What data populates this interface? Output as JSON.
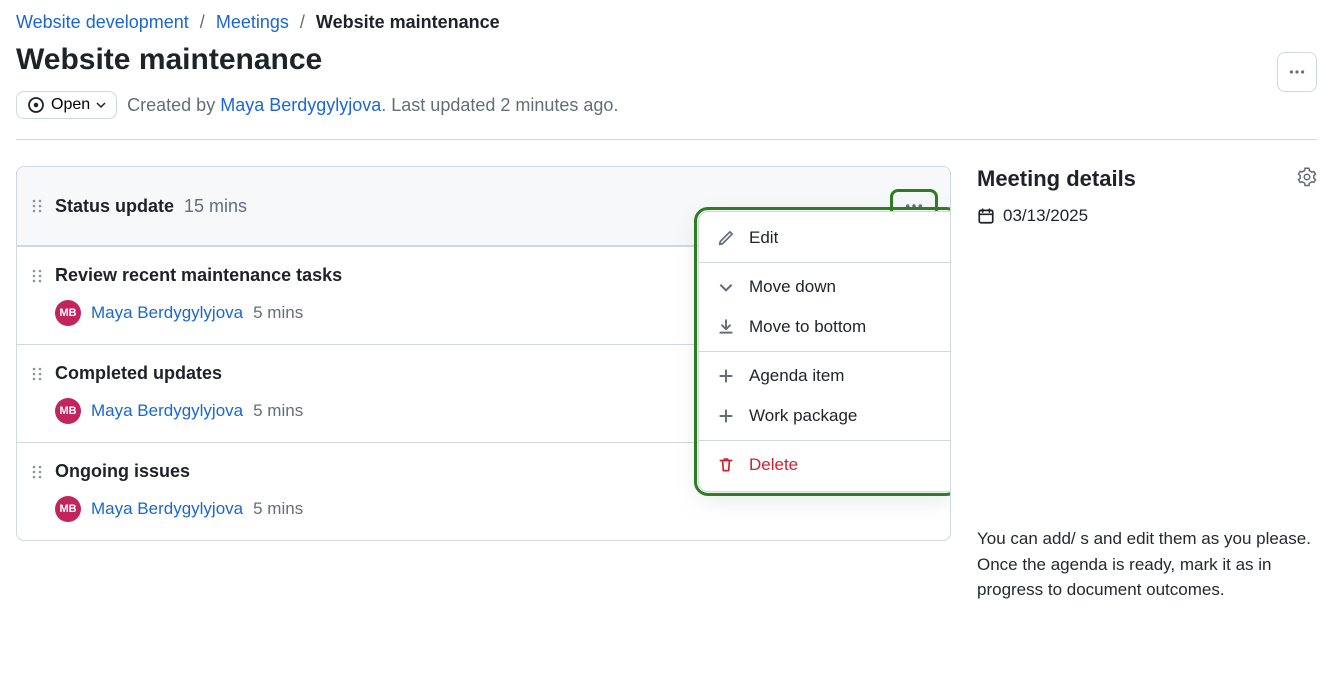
{
  "breadcrumb": {
    "root": "Website development",
    "mid": "Meetings",
    "current": "Website maintenance"
  },
  "page": {
    "title": "Website maintenance",
    "status_label": "Open",
    "created_by_prefix": "Created by ",
    "created_by": "Maya Berdygylyjova",
    "updated_suffix": ". Last updated 2 minutes ago."
  },
  "agenda": {
    "group": {
      "title": "Status update",
      "duration": "15 mins"
    },
    "items": [
      {
        "title": "Review recent maintenance tasks",
        "assignee": "Maya Berdygylyjova",
        "initials": "MB",
        "duration": "5 mins"
      },
      {
        "title": "Completed updates",
        "assignee": "Maya Berdygylyjova",
        "initials": "MB",
        "duration": "5 mins"
      },
      {
        "title": "Ongoing issues",
        "assignee": "Maya Berdygylyjova",
        "initials": "MB",
        "duration": "5 mins"
      }
    ]
  },
  "menu": {
    "edit": "Edit",
    "move_down": "Move down",
    "move_bottom": "Move to bottom",
    "agenda_item": "Agenda item",
    "work_package": "Work package",
    "delete": "Delete"
  },
  "details": {
    "heading": "Meeting details",
    "date": "03/13/2025",
    "help_text": "You can add/ s and edit them as you please. Once the agenda is ready, mark it as in progress to document outcomes."
  }
}
